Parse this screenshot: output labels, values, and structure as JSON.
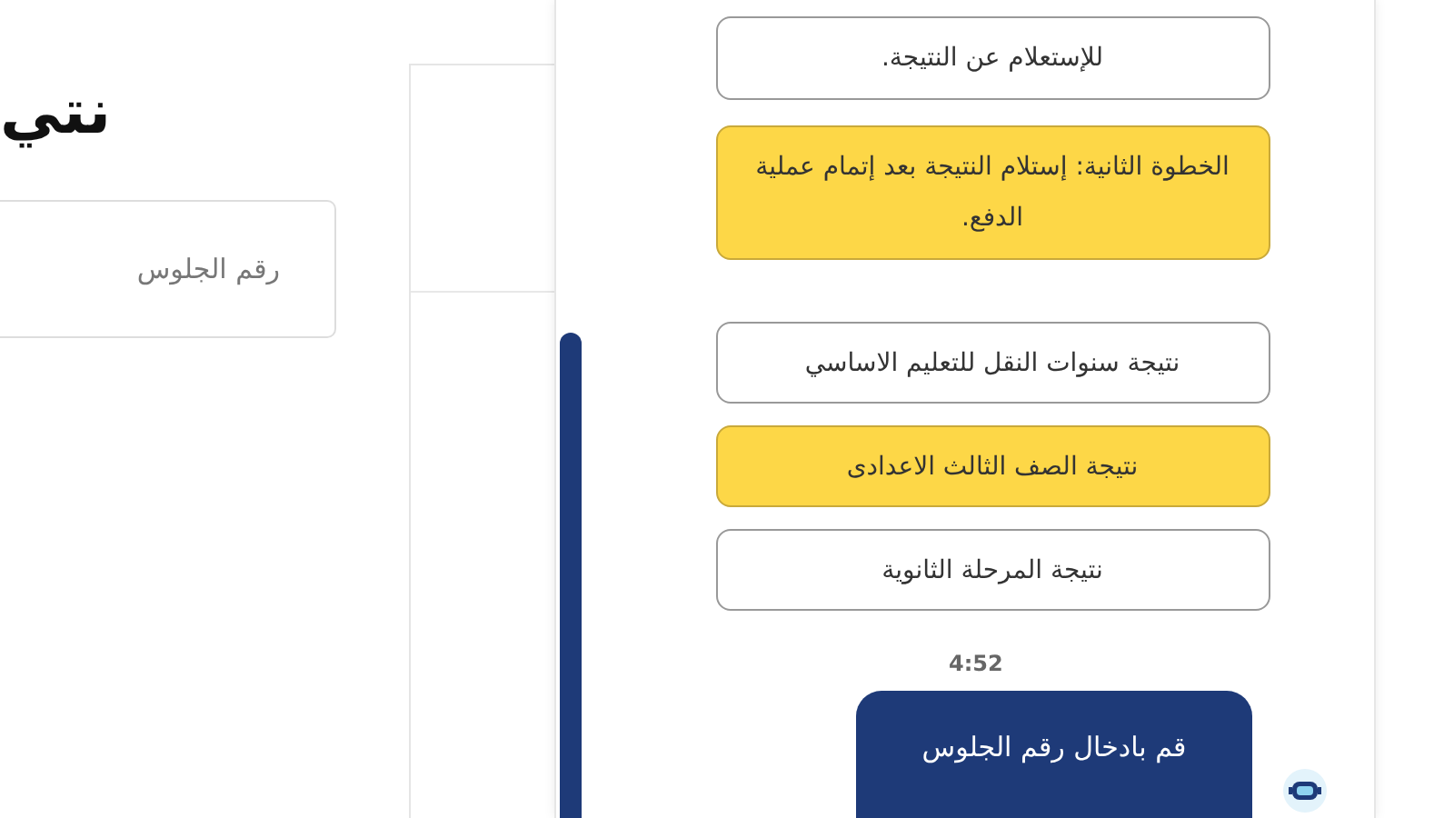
{
  "page": {
    "heading": "نتي",
    "seat_field": {
      "placeholder": "رقم الجلوس"
    }
  },
  "chat": {
    "messages": [
      {
        "kind": "bot",
        "highlighted": false,
        "text": "للإستعلام عن النتيجة."
      },
      {
        "kind": "bot",
        "highlighted": true,
        "text": "الخطوة الثانية: إستلام النتيجة بعد إتمام عملية الدفع."
      }
    ],
    "options": [
      {
        "label": "نتيجة سنوات النقل للتعليم الاساسي",
        "selected": false
      },
      {
        "label": "نتيجة الصف الثالث الاعدادى",
        "selected": true
      },
      {
        "label": "نتيجة المرحلة الثانوية",
        "selected": false
      }
    ],
    "time": "4:52",
    "user_message": "قم بادخال رقم الجلوس"
  }
}
